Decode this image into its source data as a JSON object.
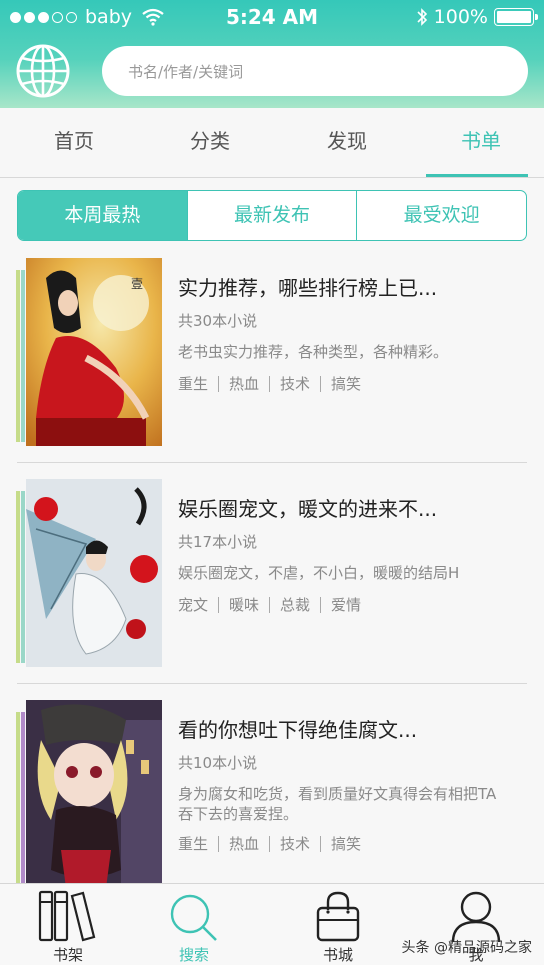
{
  "status_bar": {
    "carrier": "baby",
    "time": "5:24 AM",
    "battery": "100%"
  },
  "search": {
    "placeholder": "书名/作者/关键词"
  },
  "tabs": [
    {
      "label": "首页"
    },
    {
      "label": "分类"
    },
    {
      "label": "发现"
    },
    {
      "label": "书单",
      "active": true
    }
  ],
  "segments": [
    {
      "label": "本周最热",
      "active": true
    },
    {
      "label": "最新发布"
    },
    {
      "label": "最受欢迎"
    }
  ],
  "books": [
    {
      "title": "实力推荐，哪些排行榜上已...",
      "count": "共30本小说",
      "desc": "老书虫实力推荐，各种类型，各种精彩。",
      "tags": [
        "重生",
        "热血",
        "技术",
        "搞笑"
      ]
    },
    {
      "title": "娱乐圈宠文，暖文的进来不...",
      "count": "共17本小说",
      "desc": "娱乐圈宠文，不虐，不小白，暖暖的结局H",
      "tags": [
        "宠文",
        "暖味",
        "总裁",
        "爱情"
      ]
    },
    {
      "title": "看的你想吐下得绝佳腐文...",
      "count": "共10本小说",
      "desc": "身为腐女和吃货，看到质量好文真得会有相把TA吞下去的喜爱捏。",
      "tags": [
        "重生",
        "热血",
        "技术",
        "搞笑"
      ]
    }
  ],
  "bottom_nav": [
    {
      "label": "书架",
      "icon": "bookshelf-icon"
    },
    {
      "label": "搜索",
      "icon": "search-icon",
      "active": true
    },
    {
      "label": "书城",
      "icon": "shopping-bag-icon"
    },
    {
      "label": "我",
      "icon": "user-icon"
    }
  ],
  "watermark": "头条 @精品源码之家",
  "colors": {
    "accent": "#3ec3b4",
    "header_top": "#35c8b9",
    "header_bottom": "#a8e6c9"
  }
}
